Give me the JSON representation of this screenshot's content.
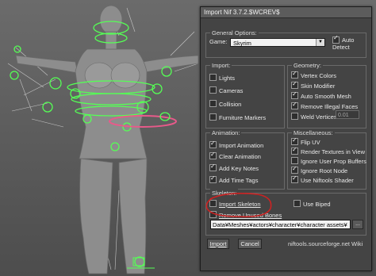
{
  "dialog": {
    "title": "Import Nif 3.7.2.$WCREV$",
    "general": {
      "title": "General Options:",
      "game_label": "Game:",
      "game_value": "Skyrim",
      "auto_detect": "Auto Detect",
      "auto_detect_checked": true
    },
    "import": {
      "title": "Import:",
      "items": [
        {
          "label": "Lights",
          "checked": false
        },
        {
          "label": "Cameras",
          "checked": false
        },
        {
          "label": "Collision",
          "checked": false
        },
        {
          "label": "Furniture Markers",
          "checked": false
        }
      ]
    },
    "geometry": {
      "title": "Geometry:",
      "items": [
        {
          "label": "Vertex Colors",
          "checked": true
        },
        {
          "label": "Skin Modifier",
          "checked": true
        },
        {
          "label": "Auto Smooth Mesh",
          "checked": true
        },
        {
          "label": "Remove Illegal Faces",
          "checked": true
        },
        {
          "label": "Weld Vertices",
          "checked": false
        }
      ],
      "weld_value": "0.01"
    },
    "animation": {
      "title": "Animation:",
      "items": [
        {
          "label": "Import Animation",
          "checked": true
        },
        {
          "label": "Clear Animation",
          "checked": true
        },
        {
          "label": "Add Key Notes",
          "checked": true
        },
        {
          "label": "Add Time Tags",
          "checked": true
        }
      ]
    },
    "misc": {
      "title": "Miscellaneous:",
      "items": [
        {
          "label": "Flip UV",
          "checked": true
        },
        {
          "label": "Render Textures in View",
          "checked": true
        },
        {
          "label": "Ignore User Prop Buffers",
          "checked": false
        },
        {
          "label": "Ignore Root Node",
          "checked": true
        },
        {
          "label": "Use Niftools Shader",
          "checked": true
        }
      ]
    },
    "skeleton": {
      "title": "Skeleton:",
      "import_skeleton": "Import Skeleton",
      "import_skeleton_checked": false,
      "use_biped": "Use Biped",
      "use_biped_checked": false,
      "remove_unused": "Remove Unused Bones",
      "remove_unused_checked": false,
      "path": "Data¥Meshes¥actors¥character¥character assets¥",
      "browse": "..."
    },
    "buttons": {
      "import": "Import",
      "cancel": "Cancel"
    },
    "footer": {
      "site": "niftools.sourceforge.net",
      "wiki": "Wiki"
    }
  },
  "colors": {
    "highlight_circle": "#cc2222",
    "bone_green": "#55ff55",
    "ring_pink": "#e85a8a"
  }
}
